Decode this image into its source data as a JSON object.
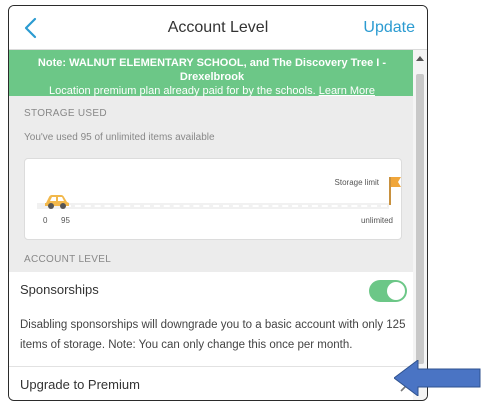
{
  "header": {
    "title": "Account Level",
    "update_label": "Update"
  },
  "note": {
    "line1": "Note: WALNUT ELEMENTARY SCHOOL, and The Discovery Tree I - Drexelbrook",
    "line2_prefix": "Location premium plan already paid for by the schools.",
    "learn_more": "Learn More"
  },
  "storage": {
    "section_label": "STORAGE USED",
    "usage_text": "You've used 95 of unlimited items available",
    "limit_label": "Storage limit",
    "min_label": "0",
    "used_label": "95",
    "max_label": "unlimited",
    "used_value": 95
  },
  "account_level": {
    "section_label": "ACCOUNT LEVEL",
    "sponsorships_label": "Sponsorships",
    "sponsorships_on": true,
    "description": "Disabling sponsorships will downgrade you to a basic account with only 125 items of storage. Note: You can only change this once per month.",
    "upgrade_label": "Upgrade to Premium"
  },
  "colors": {
    "accent_blue": "#2b9bd1",
    "banner_green": "#6cc787",
    "callout_arrow": "#4a74c4"
  }
}
